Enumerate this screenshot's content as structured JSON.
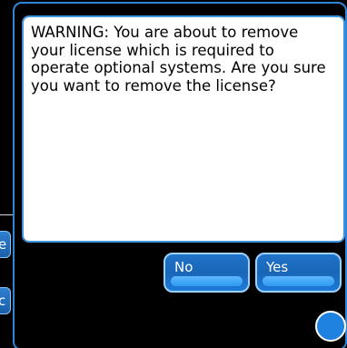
{
  "background_app": {
    "tab_1_label": "e",
    "tab_2_label": "c"
  },
  "dialog": {
    "message": "WARNING: You are about to remove your license which is required to operate optional systems.  Are you sure you want to remove the license?",
    "buttons": {
      "no_label": "No",
      "yes_label": "Yes"
    }
  },
  "colors": {
    "accent": "#2f86d6",
    "button_fill": "#1a66b8",
    "button_border": "#9cd0ff",
    "message_bg": "#ffffff",
    "background": "#000000"
  },
  "icons": {
    "corner_button": "circle-button-icon"
  }
}
